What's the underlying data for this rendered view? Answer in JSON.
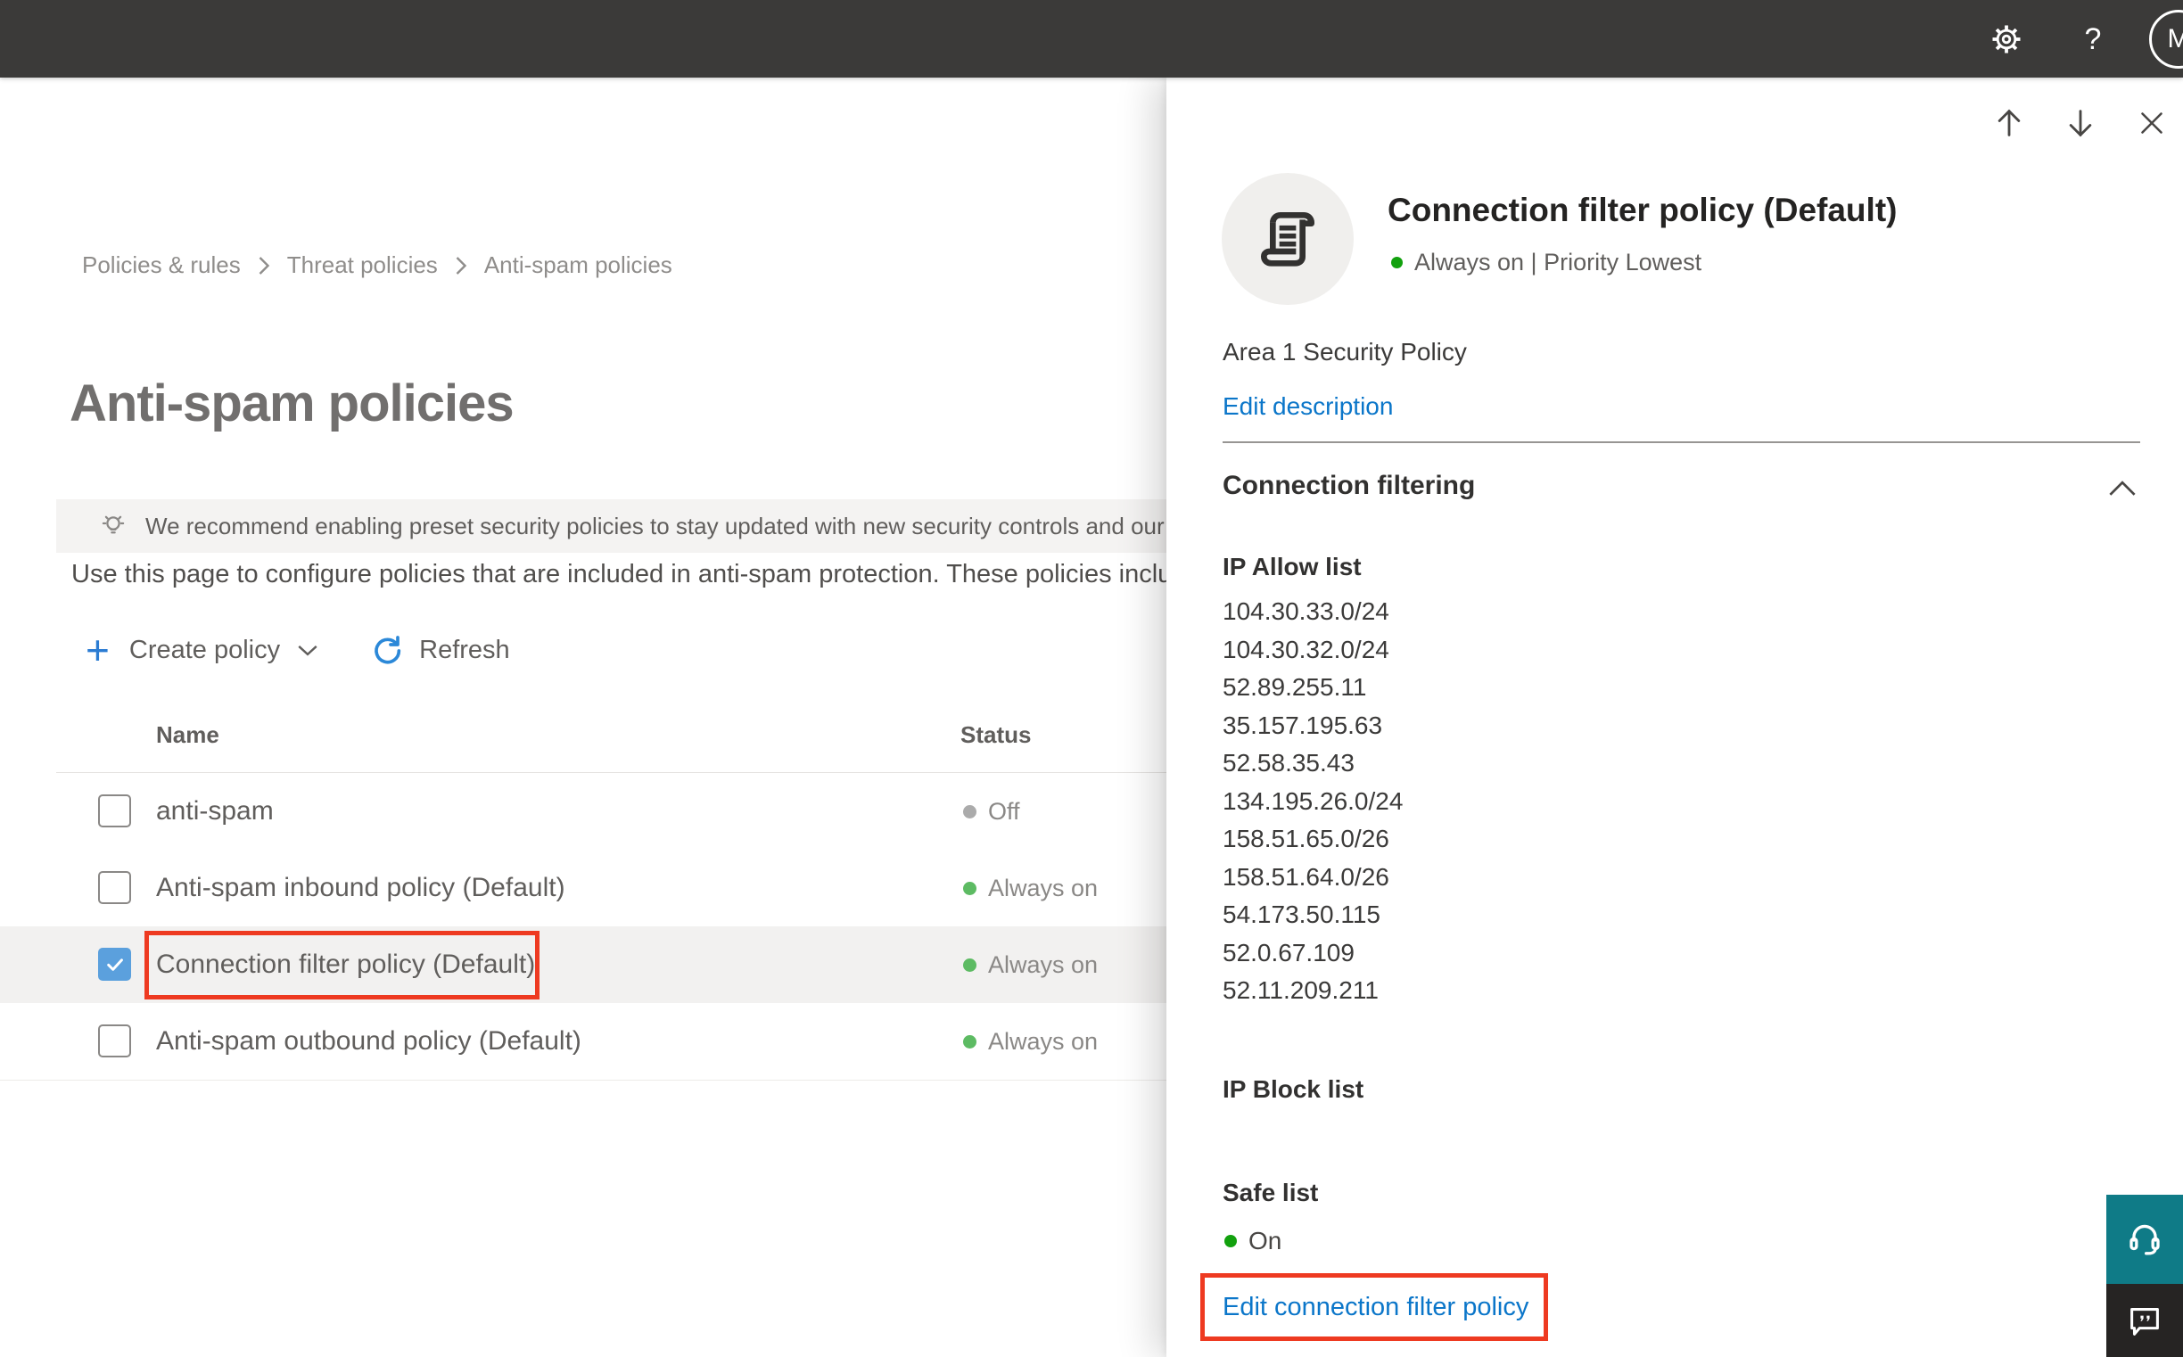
{
  "topbar": {
    "avatar_initial": "M"
  },
  "breadcrumb": {
    "items": [
      {
        "label": "Policies & rules"
      },
      {
        "label": "Threat policies"
      },
      {
        "label": "Anti-spam policies"
      }
    ]
  },
  "page": {
    "title": "Anti-spam policies",
    "banner_text": "We recommend enabling preset security policies to stay updated with new security controls and our recomme",
    "description": "Use this page to configure policies that are included in anti-spam protection. These policies include"
  },
  "toolbar": {
    "create_policy_label": "Create policy",
    "refresh_label": "Refresh"
  },
  "table": {
    "columns": {
      "name": "Name",
      "status": "Status"
    },
    "rows": [
      {
        "name": "anti-spam",
        "status": "Off",
        "state": "off",
        "checked": false
      },
      {
        "name": "Anti-spam inbound policy (Default)",
        "status": "Always on",
        "state": "on",
        "checked": false
      },
      {
        "name": "Connection filter policy (Default)",
        "status": "Always on",
        "state": "on",
        "checked": true,
        "selected": true,
        "annotated": true
      },
      {
        "name": "Anti-spam outbound policy (Default)",
        "status": "Always on",
        "state": "on",
        "checked": false
      }
    ]
  },
  "flyout": {
    "title": "Connection filter policy (Default)",
    "status_line": "Always on | Priority Lowest",
    "description": "Area 1 Security Policy",
    "edit_description_label": "Edit description",
    "section_title": "Connection filtering",
    "ip_allow": {
      "label": "IP Allow list",
      "items": [
        "104.30.33.0/24",
        "104.30.32.0/24",
        "52.89.255.11",
        "35.157.195.63",
        "52.58.35.43",
        "134.195.26.0/24",
        "158.51.65.0/26",
        "158.51.64.0/26",
        "54.173.50.115",
        "52.0.67.109",
        "52.11.209.211"
      ]
    },
    "ip_block": {
      "label": "IP Block list"
    },
    "safe_list": {
      "label": "Safe list",
      "status": "On"
    },
    "edit_policy_label": "Edit connection filter policy"
  },
  "icons": {
    "settings": "gear-icon",
    "help": "question-mark-icon",
    "avatar": "account-avatar",
    "lightbulb": "lightbulb-icon",
    "add": "plus-icon",
    "refresh": "refresh-icon",
    "chevron_down": "chevron-down-icon",
    "chevron_up": "chevron-up-icon",
    "arrow_up": "arrow-up-icon",
    "arrow_down": "arrow-down-icon",
    "close": "close-icon",
    "policy": "scroll-policy-icon",
    "support": "headset-icon",
    "feedback": "chat-feedback-icon"
  },
  "colors": {
    "topbar_dark": "#3b3a39",
    "accent_blue": "#0b76c9",
    "annotation_red": "#ee3a21",
    "status_green": "#5dbb63",
    "status_green_bright": "#12a10e",
    "status_gray": "#ababab",
    "support_teal": "#0f7b87",
    "feedback_dark": "#262423"
  }
}
